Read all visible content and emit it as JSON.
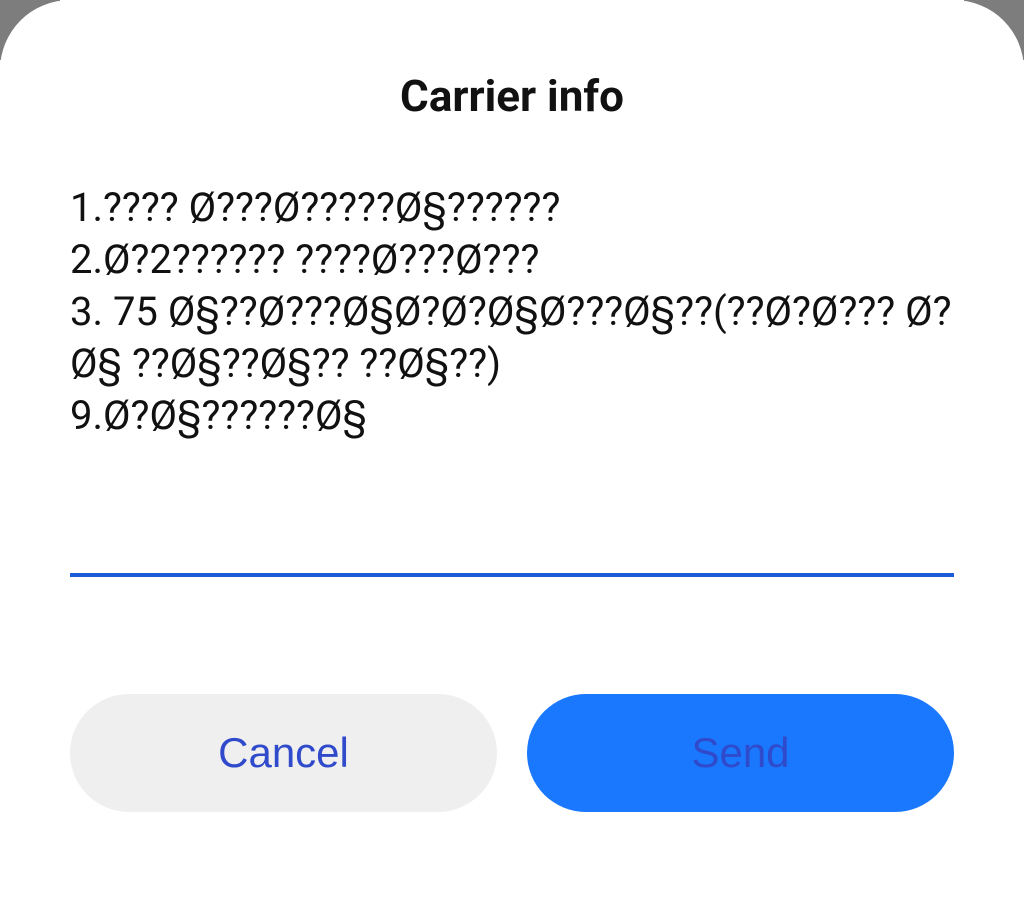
{
  "dialog": {
    "title": "Carrier info",
    "body": "1.???? Ø???Ø?????Ø§??????\n2.Ø?2?????? ????Ø???Ø???\n3. 75 Ø§??Ø???Ø§Ø?Ø?Ø§Ø???Ø§??(??Ø?Ø??? Ø?Ø§ ??Ø§??Ø§?? ??Ø§??)\n9.Ø?Ø§??????Ø§",
    "input_value": "",
    "cancel_label": "Cancel",
    "send_label": "Send"
  },
  "colors": {
    "accent": "#1a78ff",
    "underline": "#1a5dd6",
    "btn_text": "#2f4acb",
    "secondary_btn_bg": "#efefef"
  }
}
